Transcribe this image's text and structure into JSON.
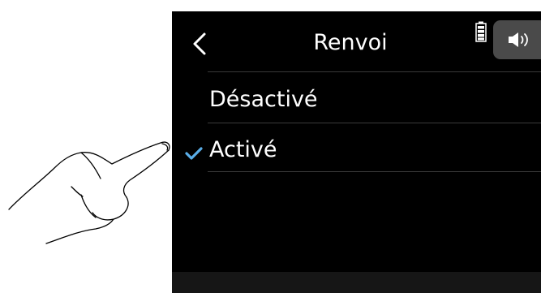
{
  "header": {
    "title": "Renvoi",
    "back_icon": "chevron-left-icon",
    "battery_icon": "battery-icon",
    "speaker_icon": "speaker-icon"
  },
  "menu": {
    "items": [
      {
        "label": "Désactivé",
        "selected": false
      },
      {
        "label": "Activé",
        "selected": true
      }
    ]
  },
  "colors": {
    "background": "#000000",
    "text": "#ffffff",
    "check": "#5aaee8",
    "speaker_button": "#4a4a4a"
  }
}
